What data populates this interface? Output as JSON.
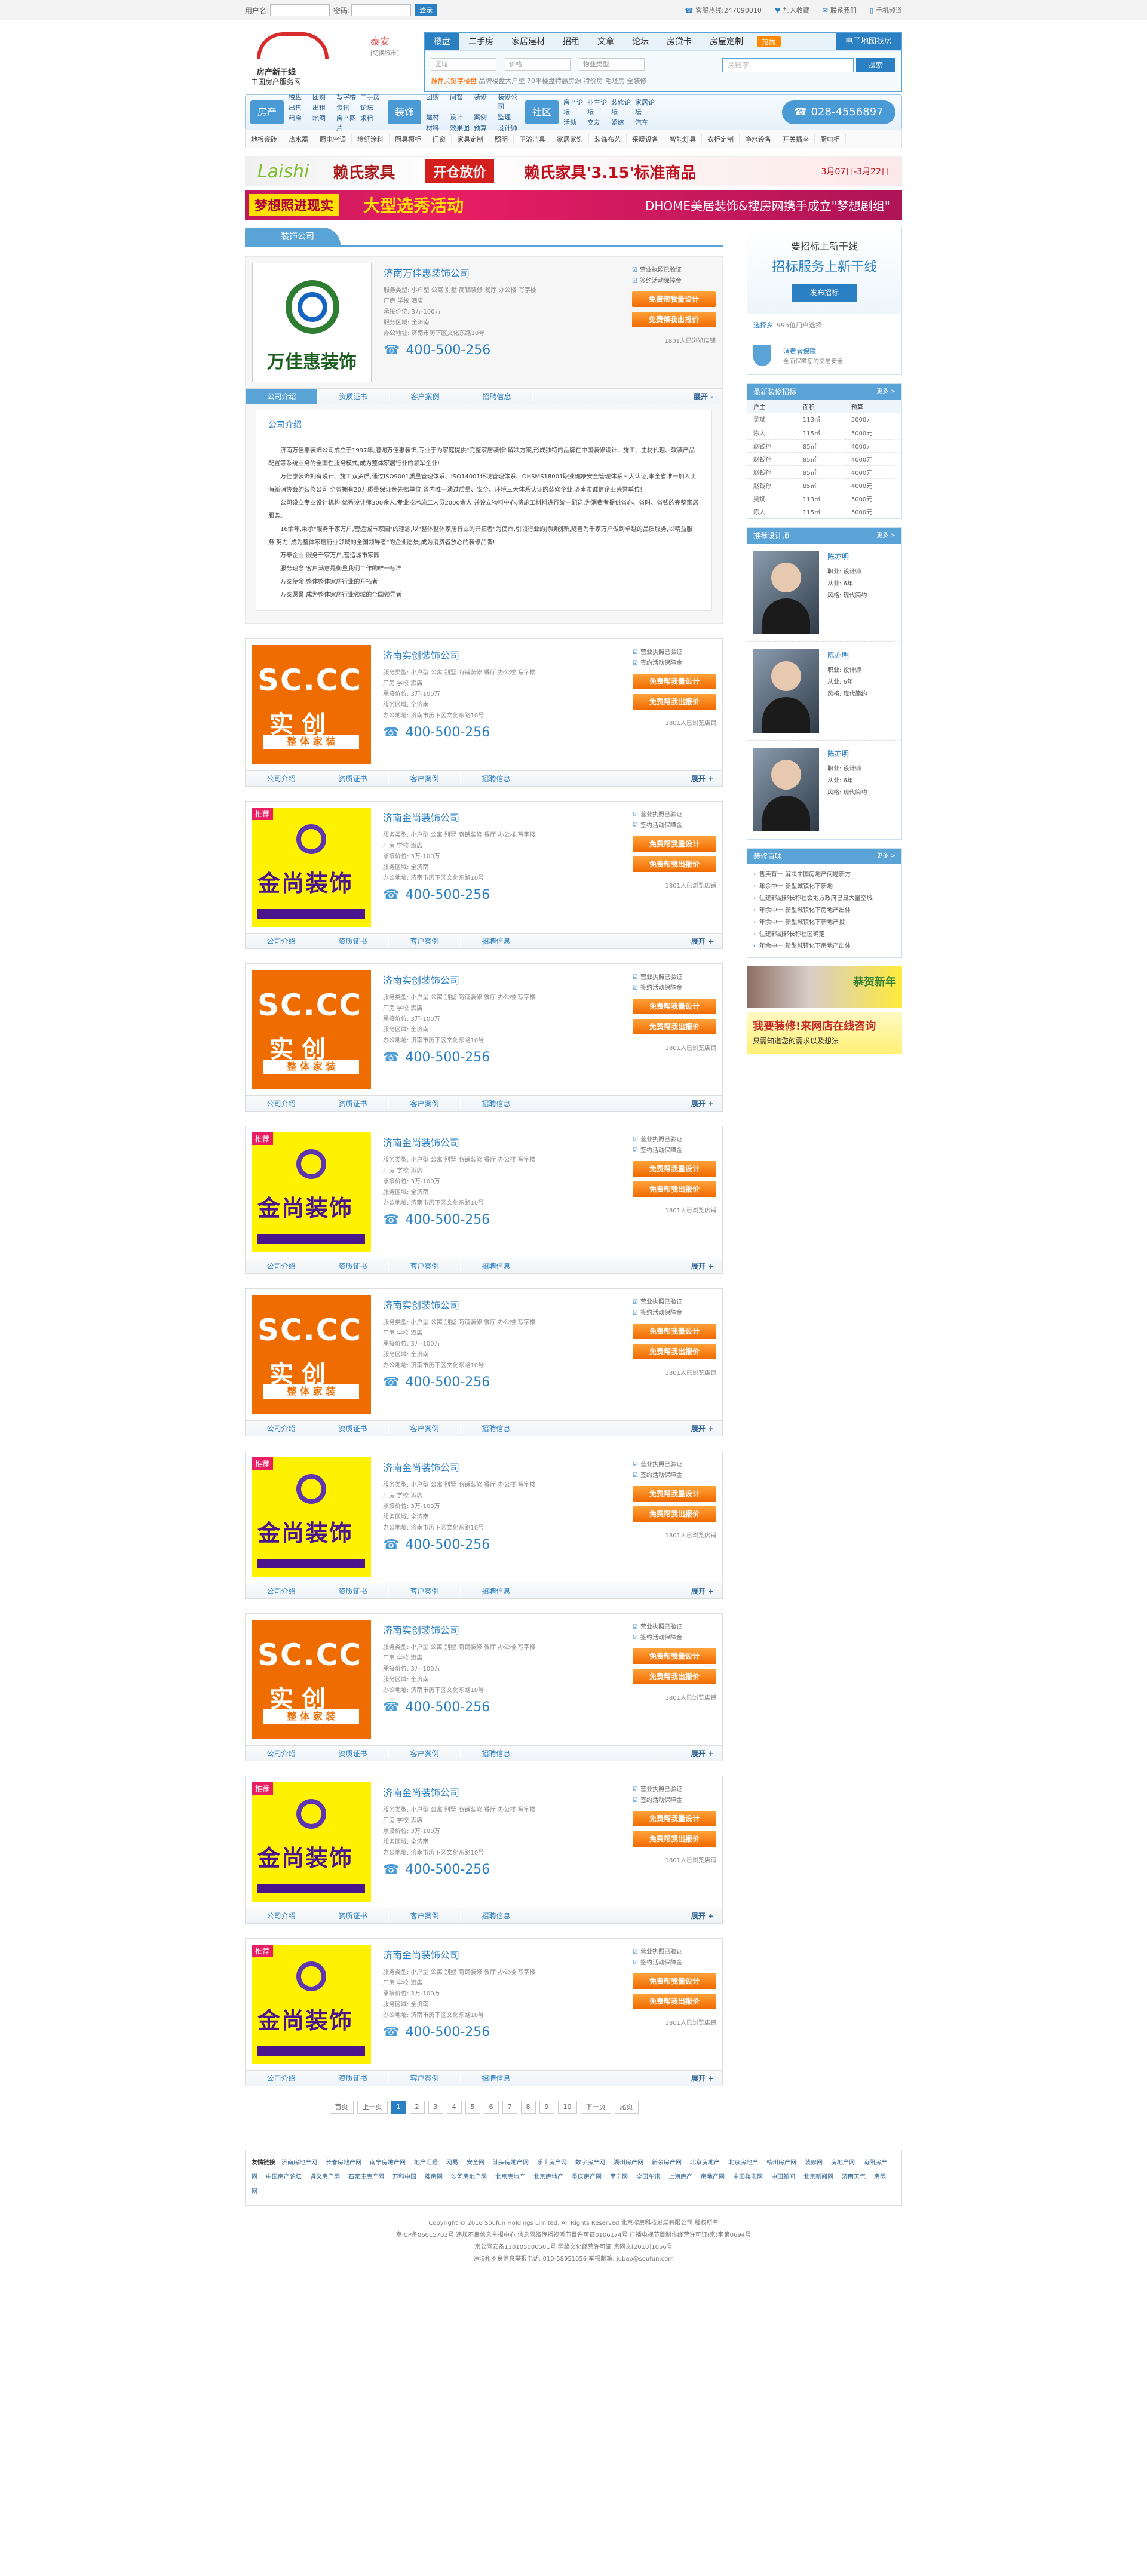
{
  "topbar": {
    "user_label": "用户名:",
    "pass_label": "密码:",
    "login": "登录",
    "links": [
      "客服热线:247090010",
      "加入收藏",
      "联系我们",
      "手机频道"
    ]
  },
  "logo": {
    "line1": "房产新干线",
    "line2": "中国房产服务网"
  },
  "city": {
    "name": "泰安",
    "switch": "[切换城市]"
  },
  "search": {
    "tabs": [
      "楼盘",
      "二手房",
      "家居建材",
      "招租",
      "文章",
      "论坛",
      "房贷卡",
      "房屋定制"
    ],
    "hot": "抢房",
    "elec": "电子地图找房",
    "selects": [
      "区域",
      "价格",
      "物业类型"
    ],
    "placeholder": "关键字",
    "go": "搜索",
    "hotkw_label": "推荐关键字楼盘",
    "hotkw": "品牌楼盘大户型  70平楼盘特惠房源  特价房 毛坯房 全装修"
  },
  "catbar": {
    "groups": [
      {
        "label": "房产",
        "links": [
          "楼盘",
          "团购",
          "写字楼",
          "二手房",
          "出售",
          "出租",
          "资讯",
          "论坛",
          "租房",
          "地图",
          "房产图片",
          "求租"
        ]
      },
      {
        "label": "装饰",
        "links": [
          "团购",
          "问答",
          "装修",
          "装修公司",
          "建材",
          "设计",
          "案例",
          "监理",
          "材料",
          "效果图",
          "预算",
          "设计师"
        ]
      },
      {
        "label": "社区",
        "links": [
          "房产论坛",
          "业主论坛",
          "装修论坛",
          "家居论坛",
          "活动",
          "交友",
          "婚嫁",
          "汽车"
        ]
      }
    ],
    "phone": "028-4556897"
  },
  "subnav": [
    "地板瓷砖",
    "热水器",
    "厨电空调",
    "墙纸涂料",
    "厨具橱柜",
    "门窗",
    "家具定制",
    "照明",
    "卫浴洁具",
    "家居家饰",
    "装饰布艺",
    "采暖设备",
    "智能灯具",
    "衣柜定制",
    "净水设备",
    "开关插座",
    "厨电柜"
  ],
  "banner1": {
    "brand": "Laishi",
    "cn": "赖氏家具",
    "tag": "开仓放价",
    "slogan": "赖氏家具'3.15'标准商品",
    "date": "3月07日-3月22日"
  },
  "banner2": {
    "tag": "梦想照进现实",
    "big": "大型选秀活动",
    "side": "DHOME美居装饰&搜房网携手成立\"梦想剧组\""
  },
  "section": {
    "title": "装饰公司"
  },
  "companies": [
    {
      "name": "济南万佳惠装饰公司",
      "type": "wj",
      "logo_text": "万佳惠装饰",
      "first": true
    },
    {
      "name": "济南实创装饰公司",
      "type": "sc",
      "logo_text": "SC.CC",
      "logo_text2": "实 创",
      "logo_bar": "整 体 家 装"
    },
    {
      "name": "济南金尚装饰公司",
      "type": "js",
      "logo_text": "金尚装饰",
      "tag": "推荐"
    },
    {
      "name": "济南实创装饰公司",
      "type": "sc",
      "logo_text": "SC.CC",
      "logo_text2": "实 创",
      "logo_bar": "整 体 家 装"
    },
    {
      "name": "济南金尚装饰公司",
      "type": "js",
      "logo_text": "金尚装饰",
      "tag": "推荐"
    },
    {
      "name": "济南实创装饰公司",
      "type": "sc",
      "logo_text": "SC.CC",
      "logo_text2": "实 创",
      "logo_bar": "整 体 家 装"
    },
    {
      "name": "济南金尚装饰公司",
      "type": "js",
      "logo_text": "金尚装饰",
      "tag": "推荐"
    },
    {
      "name": "济南实创装饰公司",
      "type": "sc",
      "logo_text": "SC.CC",
      "logo_text2": "实 创",
      "logo_bar": "整 体 家 装"
    },
    {
      "name": "济南金尚装饰公司",
      "type": "js",
      "logo_text": "金尚装饰",
      "tag": "推荐"
    },
    {
      "name": "济南金尚装饰公司",
      "type": "js",
      "logo_text": "金尚装饰",
      "tag": "推荐"
    }
  ],
  "company_common": {
    "line1": "服务类型: 小户型  公寓  别墅  商铺装修  餐厅  办公楼  写字楼",
    "line2": "厂房  学校  酒店",
    "line3": "承接价位: 3万-100万",
    "line4": "服务区域: 全济南",
    "line5": "办公地址: 济南市历下区文化东路10号",
    "tel": "400-500-256",
    "chk1": "营业执照已验证",
    "chk2": "签约活动保障金",
    "btn1": "免费帮我量设计",
    "btn2": "免费帮我出报价",
    "note": "1801人已浏览店铺",
    "tabs": [
      "公司介绍",
      "资质证书",
      "客户案例",
      "招聘信息"
    ],
    "more": "展开 +",
    "more_open": "展开 -"
  },
  "intro": {
    "title": "公司介绍",
    "paras": [
      "济南万佳惠装饰公司成立于1997年,潜谢万佳惠装饰,专业于为家庭提供\"完整家居装修\"解决方案,形成独特的品牌在中国装修设计、施工、主材代理、软装产品配置等系统业务的全国性服务模式,成为整体家居行业的领军企业!",
      "万佳惠装饰拥有设计、施工双资质,通过ISO9001质量管理体系、ISO14001环境管理体系、OHSMS18001职业健康安全管理体系三大认证,来全省唯一加入上海新消协会的装修公司,全省拥有20万质量保证金先赔单位,省内唯一通过质量、安全、环境三大体系认证的装修企业,济南市诚信企业荣誉单位!",
      "公司设立专业设计机构,优秀设计师300余人,专业技术施工人员2000余人,并设立物料中心,将施工材料进行统一配送,为消费者提供省心、省时、省钱的完整家居服务。",
      "16余年,秉承\"服务千家万户,营造城市家园\"的理念,以\"整体整体家居行业的开拓者\"为使命,引领行业的持续创新,随着为千家万户做到卓越的品质服务,以精益服务,努力\"成为整体家居行业领域的全国领导者\"的企业愿景,成为消费者放心的装修品牌!",
      "万泰企业:服务千家万户,营造城市家园",
      "服务理念:客户满意是衡量我们工作的唯一标准",
      "万泰使命:整体整体家居行业的开拓者",
      "万泰愿景:成为整体家居行业领域的全国领导者"
    ]
  },
  "pager": [
    "首页",
    "上一页",
    "1",
    "2",
    "3",
    "4",
    "5",
    "6",
    "7",
    "8",
    "9",
    "10",
    "下一页",
    "尾页"
  ],
  "right": {
    "promo_l1": "要招标上新干线",
    "promo_l2": "招标服务上新干线",
    "promo_btn": "发布招标",
    "sub_label": "选择乡",
    "sub_text": "995位用户选择",
    "ins": "消费者保障",
    "ins_sub": "全面保障您的交易安全",
    "tender_title": "最新装修招标",
    "tender_more": "更多 >",
    "tender_cols": [
      "户主",
      "面积",
      "预算"
    ],
    "tenders": [
      [
        "吴斌",
        "113㎡",
        "5000元"
      ],
      [
        "陈大",
        "115㎡",
        "5000元"
      ],
      [
        "赵钱孙",
        "85㎡",
        "4000元"
      ],
      [
        "赵钱孙",
        "85㎡",
        "4000元"
      ],
      [
        "赵钱孙",
        "85㎡",
        "4000元"
      ],
      [
        "赵钱孙",
        "85㎡",
        "4000元"
      ],
      [
        "吴斌",
        "113㎡",
        "5000元"
      ],
      [
        "陈大",
        "115㎡",
        "5000元"
      ]
    ],
    "designer_title": "推荐设计师",
    "designer_more": "更多 >",
    "designers": [
      {
        "name": "陈亦明",
        "l1": "职业: 设计师",
        "l2": "从业: 6年",
        "l3": "风格: 现代简约"
      },
      {
        "name": "陈亦明",
        "l1": "职业: 设计师",
        "l2": "从业: 6年",
        "l3": "风格: 现代简约"
      },
      {
        "name": "陈亦明",
        "l1": "职业: 设计师",
        "l2": "从业: 6年",
        "l3": "风格: 现代简约"
      }
    ],
    "news_title": "装修百味",
    "news_more": "更多 >",
    "news": [
      "售卖有一:解决中国房地产问题新方",
      "年余中一:新型城镇化下新地",
      "住建部副部长称社会地方政府已显大量空城",
      "年余中一:新型城镇化下房地产出体",
      "年余中一:新型城镇化下新地产投",
      "住建部副部长称社区确定",
      "年余中一:新型城镇化下房地产出体"
    ],
    "ad1": "恭贺新年",
    "ad2_l1": "我要装修!来网店在线咨询",
    "ad2_l2": "只需知道您的需求以及想法"
  },
  "friends": {
    "label": "友情链接",
    "links": [
      "济南房地产网",
      "长春房地产网",
      "南宁房地产网",
      "地产汇通",
      "网易",
      "安全网",
      "汕头房地产网",
      "乐山房产网",
      "数字房产网",
      "湖州房产网",
      "新余房产网",
      "北京房地产",
      "北京房地产",
      "赣州房产网",
      "装修网",
      "房地产网",
      "南阳房产网",
      "中国房产论坛",
      "遵义房产网",
      "石家庄房产网",
      "万科中国",
      "搜房网",
      "沙河房地产网",
      "北京房地产",
      "北京房地产",
      "重庆房产网",
      "南宁网",
      "全国车讯",
      "上海房产",
      "房地产网",
      "中国楼市网",
      "中国新闻",
      "北京新闻网",
      "济南天气",
      "房网网"
    ]
  },
  "footer": {
    "l1": "Copyright © 2016 Soufun Holdings Limited, All Rights Reserved 北京搜房科技发展有限公司 版权所有",
    "l2": "京ICP备06015703号 违规不良信息举报中心 信息网络传播视听节目许可证0106174号 广播电视节目制作经营许可证(京)字第0694号",
    "l3": "京公网安备110105000501号 网络文化经营许可证 京网文[2010]1056号",
    "l4": "违法和不良信息举报电话: 010-58951056 举报邮箱: jubao@soufun.com"
  }
}
